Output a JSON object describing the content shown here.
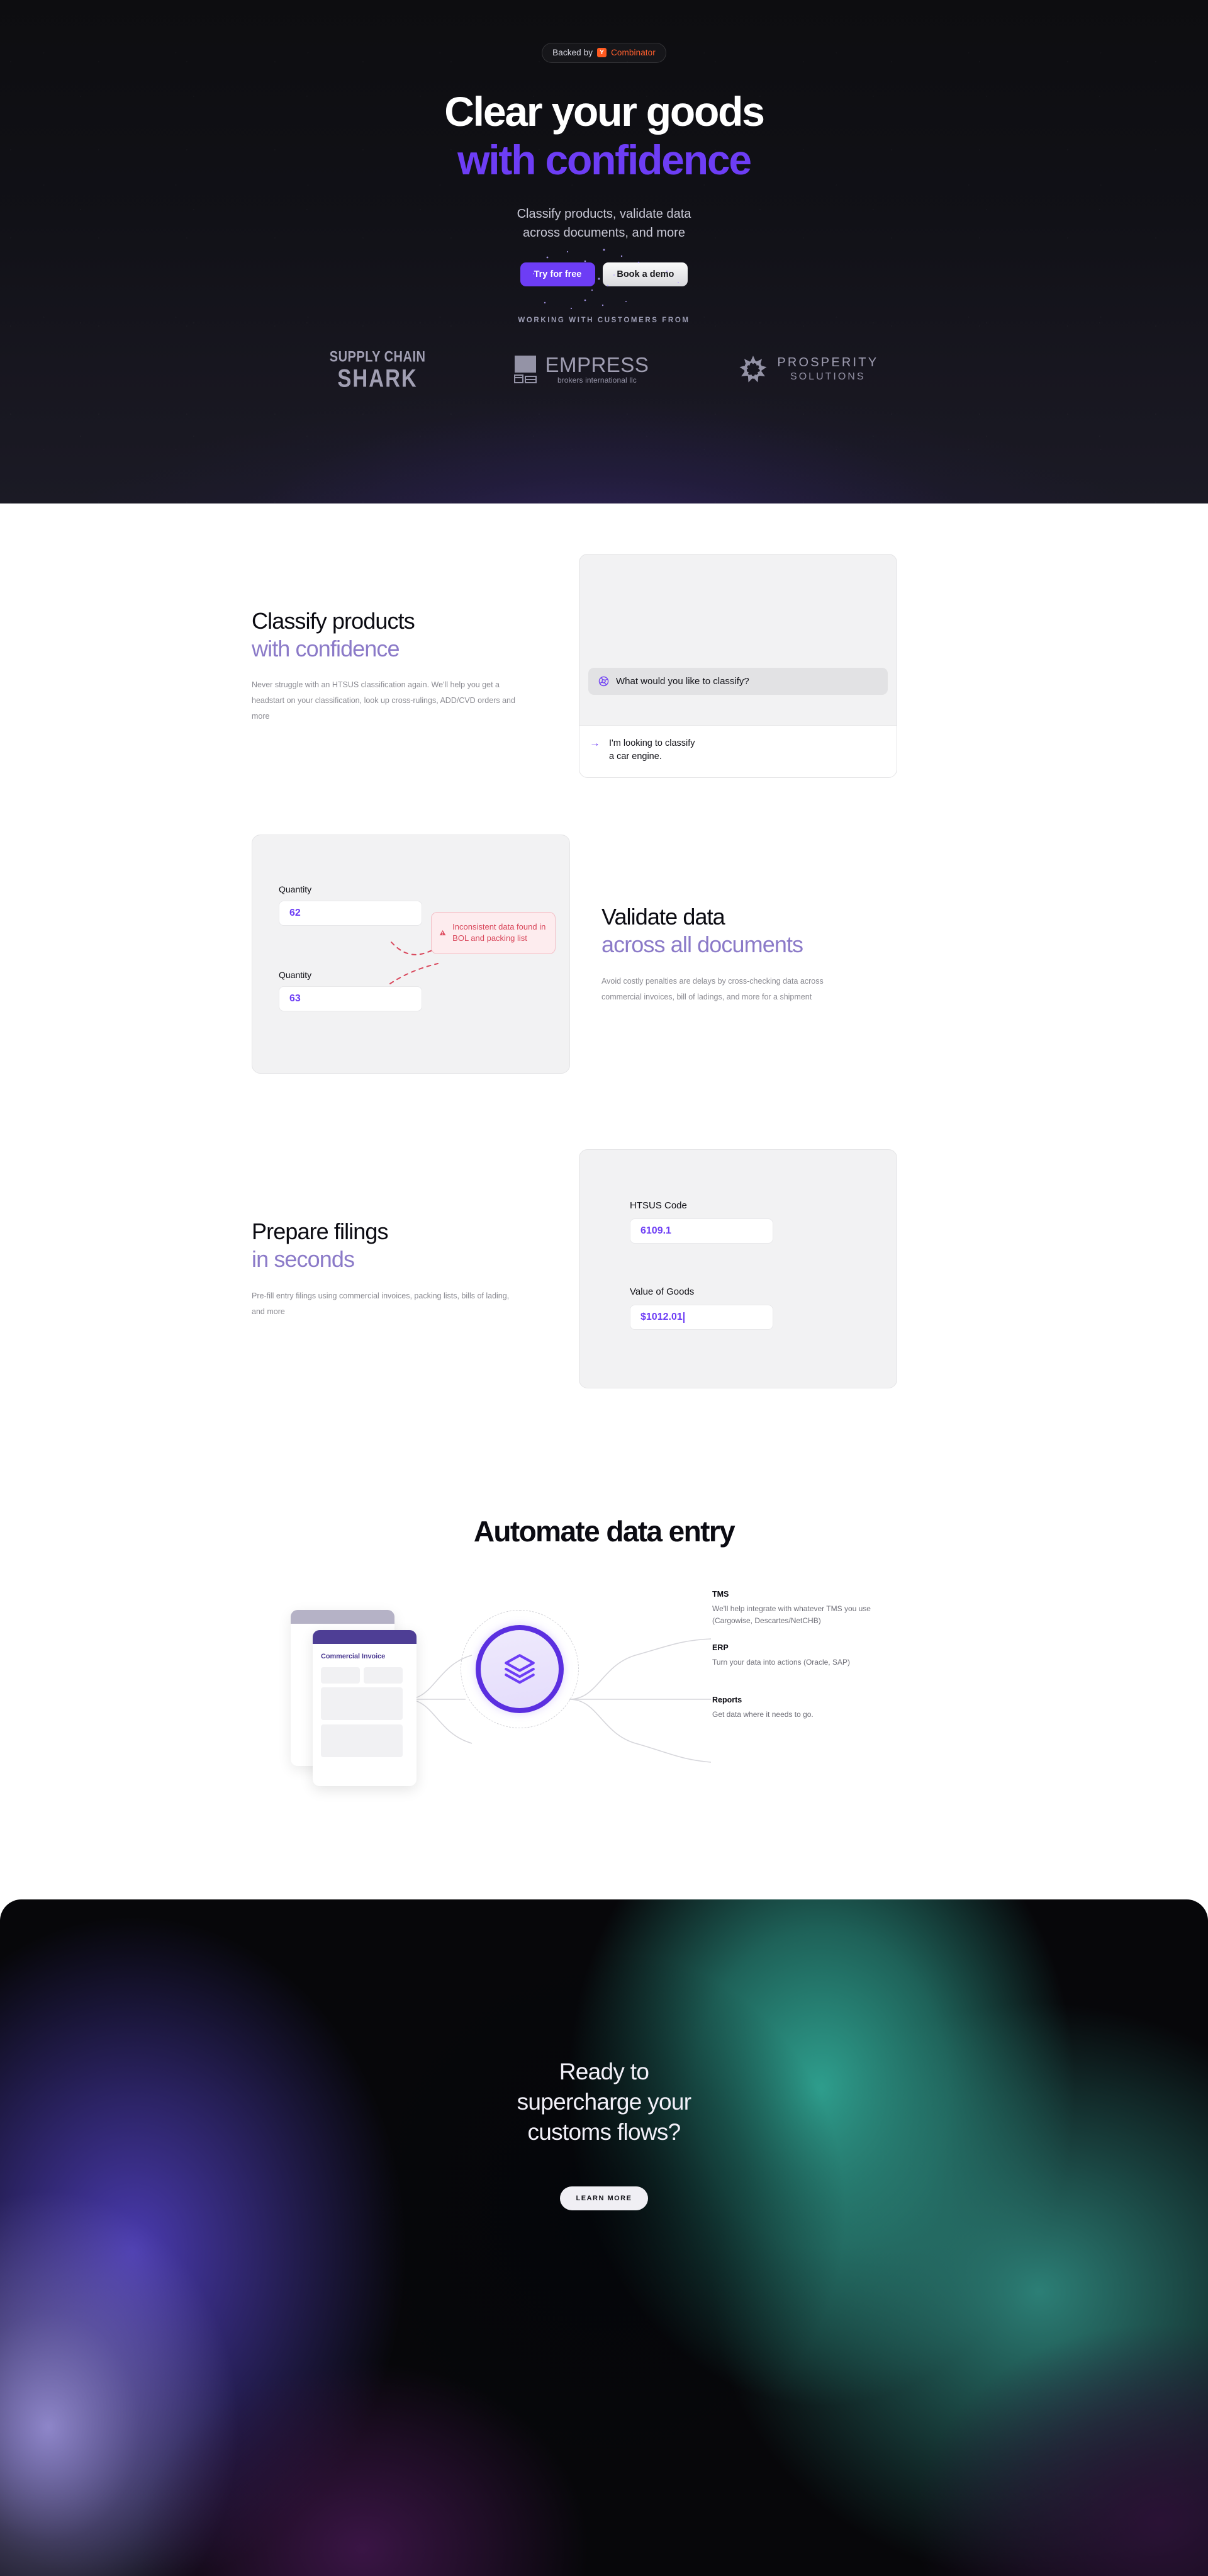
{
  "hero": {
    "badge": {
      "prefix": "Backed by",
      "mark": "Y",
      "brand": "Combinator"
    },
    "title_line1": "Clear your goods",
    "title_line2": "with confidence",
    "sub_line1": "Classify products, validate data",
    "sub_line2": "across documents, and more",
    "cta_primary": "Try for free",
    "cta_secondary": "Book a demo",
    "customers_label": "WORKING WITH CUSTOMERS FROM",
    "logos": [
      {
        "name": "supply-chain-shark",
        "line1": "SUPPLY CHAIN",
        "line2": "SHARK"
      },
      {
        "name": "empress-brokers",
        "line1": "EMPRESS",
        "line2": "brokers international llc"
      },
      {
        "name": "prosperity-solutions",
        "line1": "PROSPERITY",
        "line2": "SOLUTIONS"
      }
    ]
  },
  "features": [
    {
      "id": "classify",
      "heading": "Classify products",
      "heading_accent": "with confidence",
      "body": "Never struggle with an HTSUS classification again. We'll help you get a headstart on your classification, look up cross-rulings, ADD/CVD orders and more",
      "card": {
        "question": "What would you like to classify?",
        "answer_line1": "I'm looking to classify",
        "answer_line2": "a car engine."
      }
    },
    {
      "id": "validate",
      "heading": "Validate data",
      "heading_accent": "across all documents",
      "body": "Avoid costly penalties are delays by cross-checking data across commercial invoices, bill of ladings, and more for a shipment",
      "card": {
        "field1_label": "Quantity",
        "field1_value": "62",
        "field2_label": "Quantity",
        "field2_value": "63",
        "warning": "Inconsistent data found in BOL and packing list"
      }
    },
    {
      "id": "filings",
      "heading": "Prepare filings",
      "heading_accent": "in seconds",
      "body": "Pre-fill entry filings using commercial invoices, packing lists, bills of lading, and more",
      "card": {
        "field1_label": "HTSUS Code",
        "field1_value": "6109.1",
        "field2_label": "Value of Goods",
        "field2_value": "$1012.01"
      }
    }
  ],
  "automate": {
    "title": "Automate data entry",
    "document_title": "Commercial Invoice",
    "integrations": [
      {
        "name": "TMS",
        "desc": "We'll help integrate with whatever TMS you use (Cargowise, Descartes/NetCHB)"
      },
      {
        "name": "ERP",
        "desc": "Turn your data into actions (Oracle, SAP)"
      },
      {
        "name": "Reports",
        "desc": "Get data where it needs to go."
      }
    ]
  },
  "footer": {
    "line1": "Ready to",
    "line2": "supercharge your",
    "line3": "customs flows?",
    "button": "LEARN MORE"
  },
  "colors": {
    "accent_purple": "#6d3df5",
    "muted_purple": "#8b7ac8",
    "yc_orange": "#ff5f2e",
    "warning_red": "#d9485c",
    "dark_bg": "#111117"
  }
}
